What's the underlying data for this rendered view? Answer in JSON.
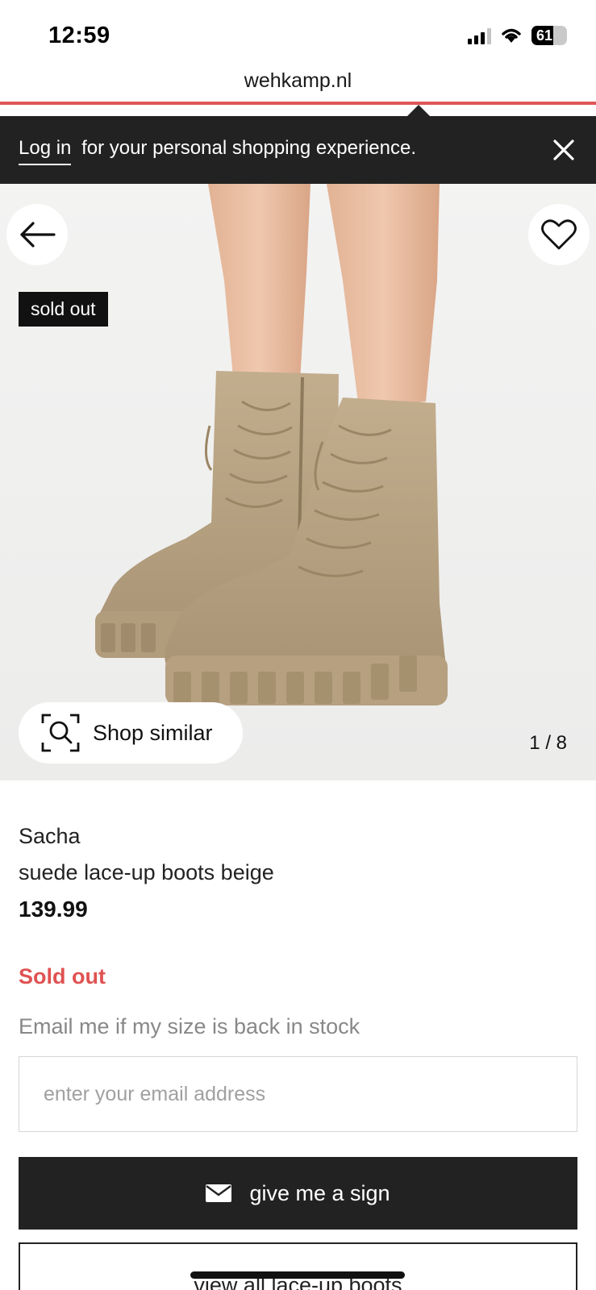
{
  "status_bar": {
    "time": "12:59",
    "battery": "61"
  },
  "browser": {
    "url": "wehkamp.nl"
  },
  "login_banner": {
    "link_text": "Log in",
    "message": "for your personal shopping experience."
  },
  "gallery": {
    "badge": "sold out",
    "shop_similar": "Shop similar",
    "counter": "1 / 8"
  },
  "product": {
    "brand": "Sacha",
    "name": "suede lace-up boots beige",
    "price": "139.99",
    "stock_status": "Sold out",
    "notify_label": "Email me if my size is back in stock",
    "email_placeholder": "enter your email address",
    "sign_button": "give me a sign",
    "view_all_button": "view all lace-up boots"
  },
  "icons": {
    "back": "arrow-left-icon",
    "favorite": "heart-icon",
    "close": "close-icon",
    "visual_search": "visual-search-icon",
    "mail": "envelope-icon",
    "signal": "signal-icon",
    "wifi": "wifi-icon",
    "battery": "battery-icon"
  },
  "colors": {
    "accent_red": "#e05252",
    "dark": "#222222",
    "muted_text": "#888888"
  }
}
